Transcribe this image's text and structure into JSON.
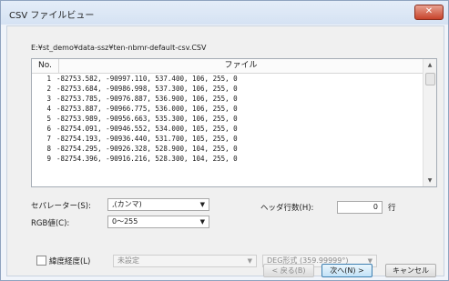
{
  "window": {
    "title": "CSV ファイルビュー",
    "close_label": "✕"
  },
  "file_path": "E:¥st_demo¥data-ssz¥ten-nbmr-default-csv.CSV",
  "table": {
    "columns": [
      "No.",
      "ファイル"
    ],
    "rows": [
      {
        "no": "1",
        "text": "-82753.582, -90997.110, 537.400, 106, 255, 0"
      },
      {
        "no": "2",
        "text": "-82753.684, -90986.998, 537.300, 106, 255, 0"
      },
      {
        "no": "3",
        "text": "-82753.785, -90976.887, 536.900, 106, 255, 0"
      },
      {
        "no": "4",
        "text": "-82753.887, -90966.775, 536.000, 106, 255, 0"
      },
      {
        "no": "5",
        "text": "-82753.989, -90956.663, 535.300, 106, 255, 0"
      },
      {
        "no": "6",
        "text": "-82754.091, -90946.552, 534.000, 105, 255, 0"
      },
      {
        "no": "7",
        "text": "-82754.193, -90936.440, 531.700, 105, 255, 0"
      },
      {
        "no": "8",
        "text": "-82754.295, -90926.328, 528.900, 104, 255, 0"
      },
      {
        "no": "9",
        "text": "-82754.396, -90916.216, 528.300, 104, 255, 0"
      }
    ]
  },
  "separator": {
    "label": "セパレーター(S):",
    "value": ",(カンマ)"
  },
  "header_rows": {
    "label": "ヘッダ行数(H):",
    "value": "0",
    "unit": "行"
  },
  "rgb": {
    "label": "RGB値(C):",
    "value": "0～255"
  },
  "latlon": {
    "label": "緯度経度(L)",
    "datum_value": "未設定",
    "format_value": "DEG形式 (359.99999°)"
  },
  "buttons": {
    "back": "< 戻る(B)",
    "next": "次へ(N) >",
    "cancel": "キャンセル"
  },
  "icons": {
    "close": "close-icon",
    "dropdown": "chevron-down-icon"
  }
}
